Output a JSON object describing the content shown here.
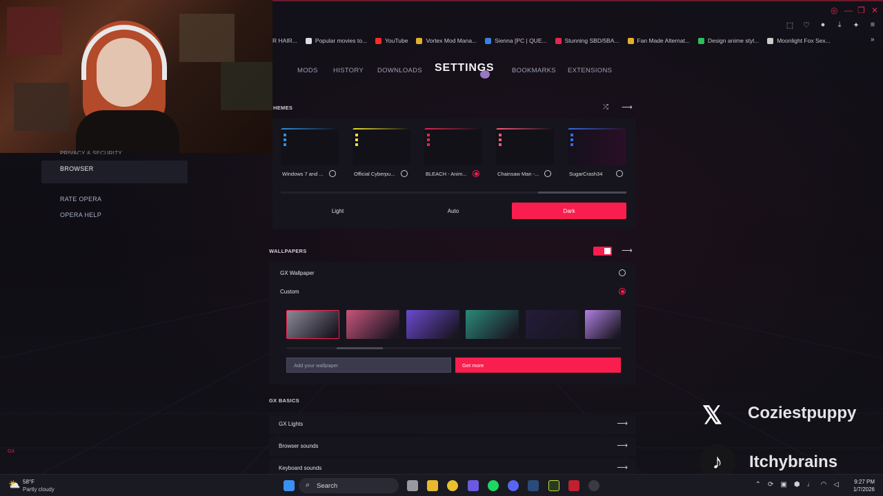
{
  "bookmarks": [
    {
      "label": "R HAIR...",
      "icon": "bookmark-icon",
      "color": "#888888"
    },
    {
      "label": "Popular movies to...",
      "icon": "page-icon",
      "color": "#dddddd"
    },
    {
      "label": "YouTube",
      "icon": "youtube-icon",
      "color": "#ff2b2b"
    },
    {
      "label": "Vortex Mod Mana...",
      "icon": "vortex-icon",
      "color": "#e0b030"
    },
    {
      "label": "Sienna [PC | QUE...",
      "icon": "shield-icon",
      "color": "#3a80e0"
    },
    {
      "label": "Stunning SBD/5BA...",
      "icon": "red-square-icon",
      "color": "#e0294f"
    },
    {
      "label": "Fan Made Alternat...",
      "icon": "star-icon",
      "color": "#e0b030"
    },
    {
      "label": "Design anime styl...",
      "icon": "green-circle-icon",
      "color": "#2cc060"
    },
    {
      "label": "Moonlight Fox Sex...",
      "icon": "link-icon",
      "color": "#cccccc"
    }
  ],
  "nav": {
    "mods": "MODS",
    "history": "HISTORY",
    "downloads": "DOWNLOADS",
    "settings": "SETTINGS",
    "bookmarks": "BOOKMARKS",
    "extensions": "EXTENSIONS"
  },
  "sidebar": {
    "partial": "PRIVACY & SECURITY",
    "browser": "BROWSER",
    "rate": "RATE OPERA",
    "help": "OPERA HELP"
  },
  "themes": {
    "title": "HEMES",
    "items": [
      {
        "name": "Windows 7 and ...",
        "accent": "#2f8fe0",
        "selected": false
      },
      {
        "name": "Official Cyberpu...",
        "accent": "#f0e030",
        "selected": false
      },
      {
        "name": "BLEACH - Anim...",
        "accent": "#e0294f",
        "selected": true
      },
      {
        "name": "Chainsaw Man -...",
        "accent": "#ff5a78",
        "selected": false
      },
      {
        "name": "SugarCrash34",
        "accent": "#3a6ae0",
        "selected": false
      }
    ],
    "modes": {
      "light": "Light",
      "auto": "Auto",
      "dark": "Dark"
    },
    "active_mode": "Dark"
  },
  "wallpapers": {
    "title": "WALLPAPERS",
    "enabled": true,
    "gx_wallpaper": "GX Wallpaper",
    "custom": "Custom",
    "selected": "Custom",
    "thumb_colors": [
      "#8a8a96",
      "#c9557a",
      "#6a4ad0",
      "#2a8a7a",
      "#241c3a",
      "#b080e0"
    ],
    "add_button": "Add your wallpaper",
    "get_more": "Get more"
  },
  "gx_basics": {
    "title": "GX BASICS",
    "rows": [
      "GX Lights",
      "Browser sounds",
      "Keyboard sounds"
    ]
  },
  "overlay": {
    "x_handle": "Coziestpuppy",
    "tiktok_handle": "Itchybrains"
  },
  "taskbar": {
    "temp": "58°F",
    "weather": "Partly cloudy",
    "search": "Search",
    "time": "9:27 PM",
    "date": "1/7/2026"
  },
  "gx_label": "GX",
  "colors": {
    "accent": "#fa1e4e",
    "panel": "#16151d",
    "background": "#0e0d13"
  }
}
